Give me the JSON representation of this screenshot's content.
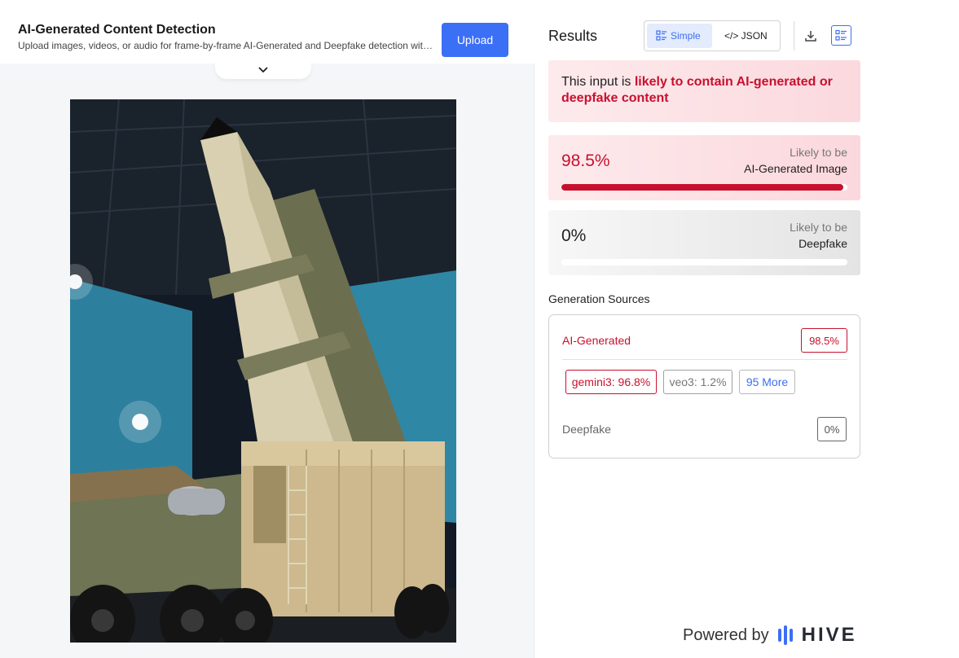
{
  "header": {
    "title": "AI-Generated Content Detection",
    "subtitle": "Upload images, videos, or audio for frame-by-frame AI-Generated and Deepfake detection with...",
    "upload_label": "Upload"
  },
  "results": {
    "title": "Results",
    "view_simple": "Simple",
    "view_json": "</> JSON",
    "icons": [
      "download-icon",
      "list-view-icon",
      "chevron-down-icon"
    ]
  },
  "verdict": {
    "prefix": "This input is ",
    "emphasis": "likely to contain AI-generated or deepfake content"
  },
  "scores": {
    "ai": {
      "value": "98.5%",
      "fraction": 0.985,
      "likely": "Likely to be",
      "target": "AI-Generated Image"
    },
    "deepfake": {
      "value": "0%",
      "fraction": 0.0,
      "likely": "Likely to be",
      "target": "Deepfake"
    }
  },
  "generation_sources": {
    "title": "Generation Sources",
    "ai_label": "AI-Generated",
    "ai_value": "98.5%",
    "chips": {
      "gemini": "gemini3: 96.8%",
      "veo": "veo3: 1.2%",
      "more": "95 More"
    },
    "deepfake_label": "Deepfake",
    "deepfake_value": "0%"
  },
  "footer": {
    "powered_by": "Powered by",
    "brand": "HIVE"
  },
  "colors": {
    "accent": "#3b6ff5",
    "danger": "#c8102e"
  }
}
